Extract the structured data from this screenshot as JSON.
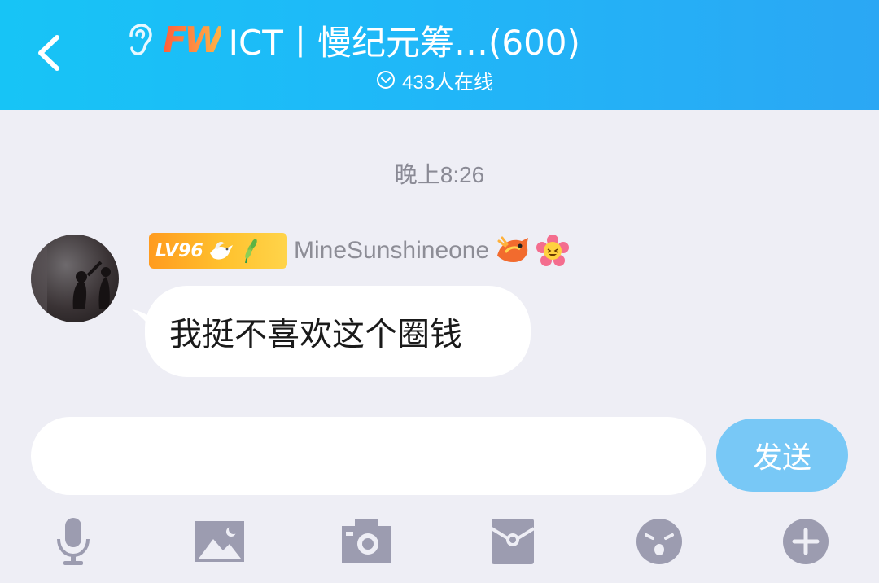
{
  "header": {
    "badge_text": "FW",
    "title": "ICT丨慢纪元筹…(600)",
    "online": "433人在线"
  },
  "chat": {
    "timestamp": "晚上8:26",
    "message": {
      "level": "LV96",
      "sender": "MineSunshineone",
      "text": "我挺不喜欢这个圈钱"
    }
  },
  "composer": {
    "input_value": "",
    "send_label": "发送"
  },
  "toolbar": {
    "items": [
      "microphone-icon",
      "image-icon",
      "camera-icon",
      "red-packet-icon",
      "emoji-icon",
      "plus-icon"
    ]
  },
  "colors": {
    "header_start": "#17c4f6",
    "header_end": "#2ba7f4",
    "send_button": "#78c8f6",
    "background": "#eeeef5",
    "toolbar_icon": "#9c9cb0"
  }
}
